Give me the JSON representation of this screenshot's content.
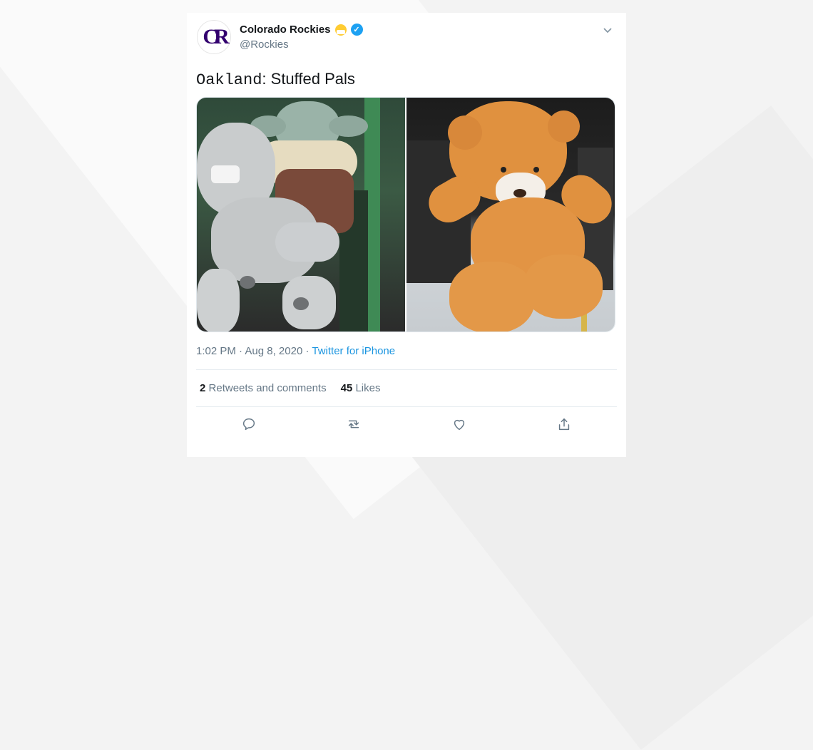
{
  "tweet": {
    "author_name": "Colorado Rockies",
    "handle": "@Rockies",
    "avatar_text": "CR",
    "text_mono": "Oakland",
    "text_rest": ": Stuffed Pals",
    "time": "1:02 PM",
    "date": "Aug 8, 2020",
    "source": "Twitter for iPhone",
    "retweets_count": "2",
    "retweets_label": "Retweets and comments",
    "likes_count": "45",
    "likes_label": "Likes"
  },
  "icons": {
    "menu": "chevron-down-icon",
    "verified": "verified-badge-icon",
    "emoji": "face-with-mask-icon",
    "reply": "reply-icon",
    "retweet": "retweet-icon",
    "like": "heart-icon",
    "share": "share-icon"
  },
  "colors": {
    "link": "#1b95e0",
    "verified": "#1da1f2",
    "brand": "#33006f"
  }
}
